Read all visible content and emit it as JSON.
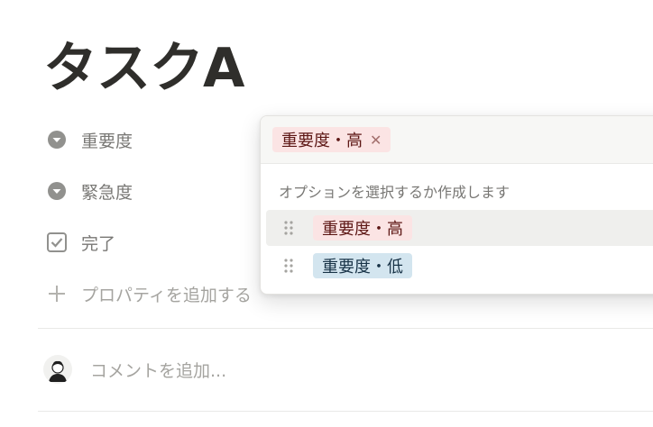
{
  "page": {
    "title": "タスクA"
  },
  "properties": [
    {
      "label": "重要度",
      "icon": "select-icon"
    },
    {
      "label": "緊急度",
      "icon": "select-icon"
    },
    {
      "label": "完了",
      "icon": "checkbox-icon"
    }
  ],
  "add_property": {
    "icon": "plus-icon",
    "label": "プロパティを追加する"
  },
  "comment": {
    "placeholder": "コメントを追加..."
  },
  "dropdown": {
    "selected_tag": "重要度・高",
    "hint": "オプションを選択するか作成します",
    "options": [
      {
        "label": "重要度・高",
        "color": "#fbe4e4"
      },
      {
        "label": "重要度・低",
        "color": "#d3e5ef"
      }
    ]
  }
}
